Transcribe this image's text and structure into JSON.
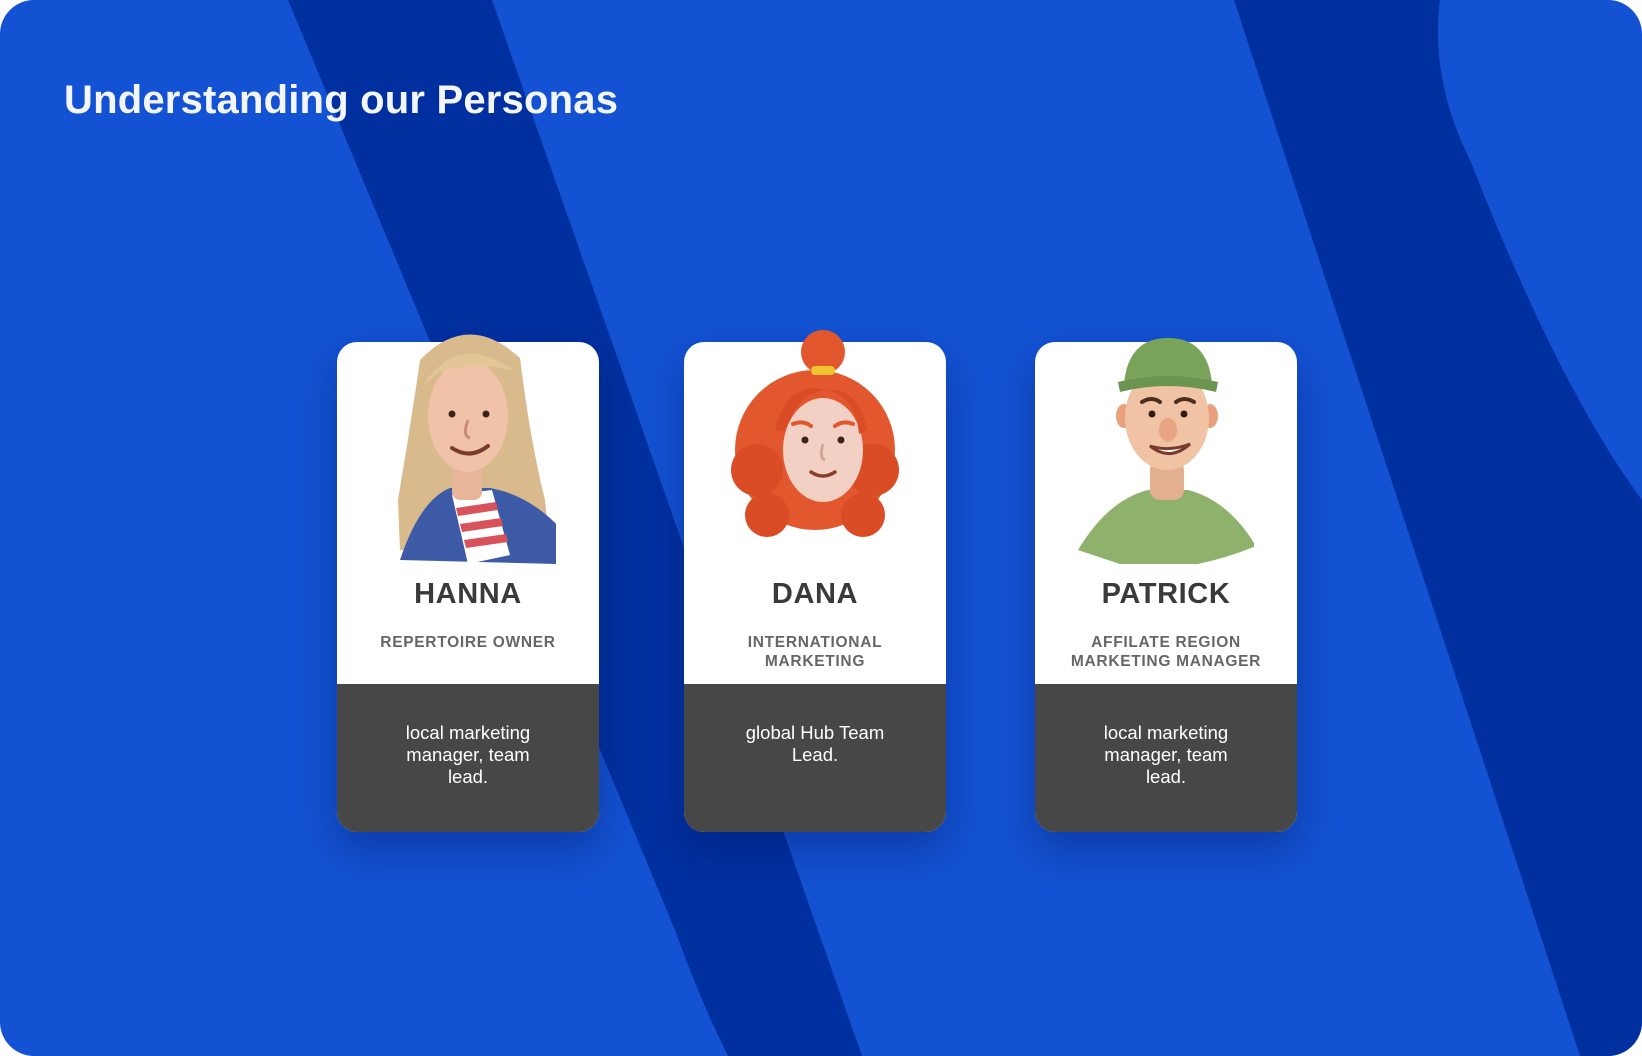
{
  "slide": {
    "title": "Understanding our Personas"
  },
  "colors": {
    "background": "#1352d2",
    "stripe": "#0030a0",
    "card": "#ffffff",
    "card_bottom": "#474747",
    "name_text": "#3a3a3a",
    "role_text": "#666666"
  },
  "personas": [
    {
      "name": "HANNA",
      "role": "REPERTOIRE OWNER",
      "description": "local marketing manager, team lead.",
      "avatar_icon": "woman-blonde-avatar-icon"
    },
    {
      "name": "DANA",
      "role": "INTERNATIONAL MARKETING",
      "description": "global Hub Team Lead.",
      "avatar_icon": "woman-redhead-avatar-icon"
    },
    {
      "name": "PATRICK",
      "role": "AFFILATE REGION MARKETING MANAGER",
      "description": "local marketing manager, team lead.",
      "avatar_icon": "man-cap-avatar-icon"
    }
  ]
}
